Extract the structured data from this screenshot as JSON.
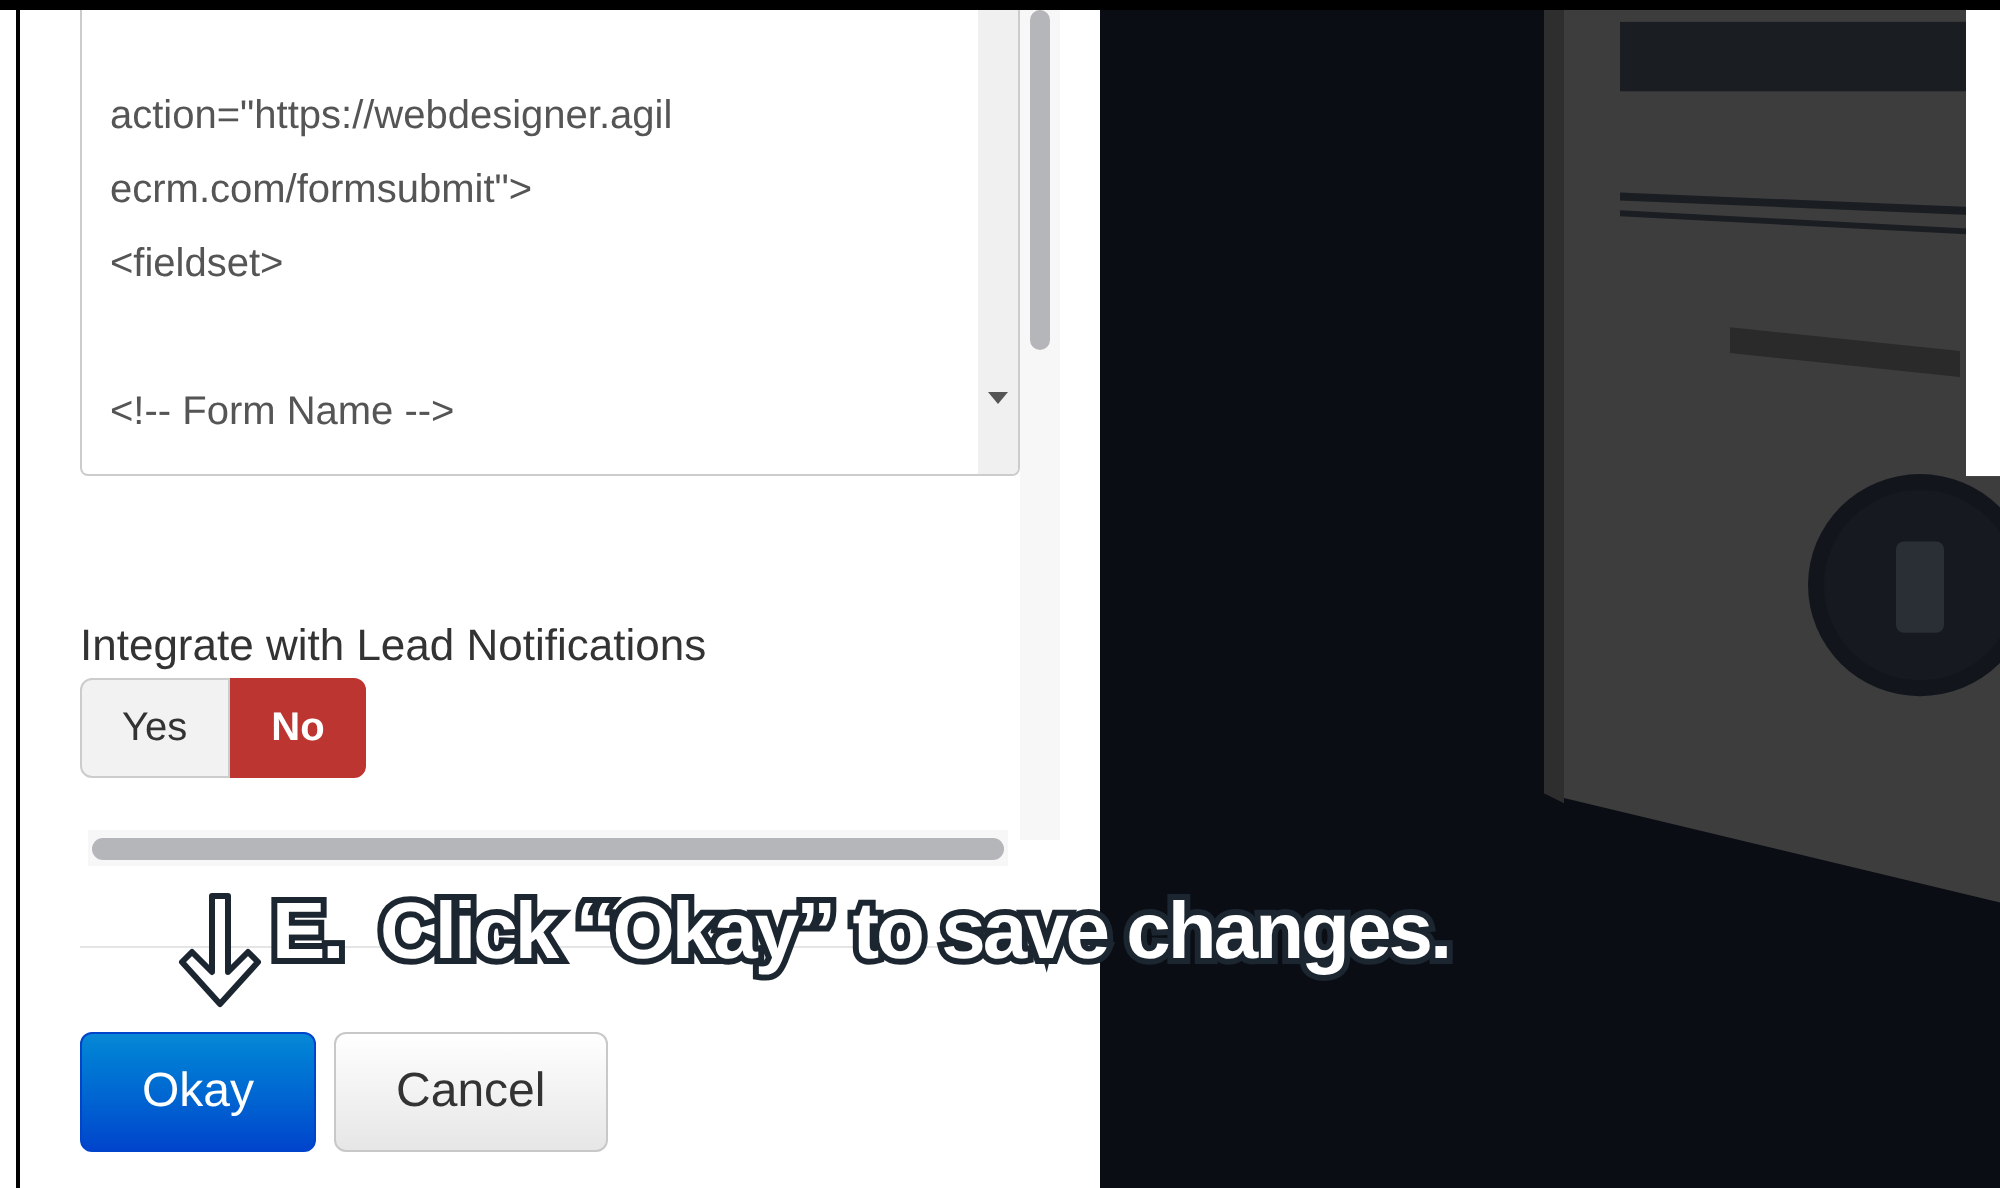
{
  "form_code": {
    "value": "action=\"https://webdesigner.agil\necrm.com/formsubmit\">\n<fieldset>\n\n<!-- Form Name -->"
  },
  "lead_notifications": {
    "label": "Integrate with Lead Notifications",
    "options": [
      {
        "label": "Yes",
        "selected": false
      },
      {
        "label": "No",
        "selected": true
      }
    ]
  },
  "buttons": [
    {
      "label": "Okay",
      "kind": "primary"
    },
    {
      "label": "Cancel",
      "kind": "secondary"
    }
  ],
  "annotation": {
    "text": "E.  Click “Okay” to save changes."
  }
}
